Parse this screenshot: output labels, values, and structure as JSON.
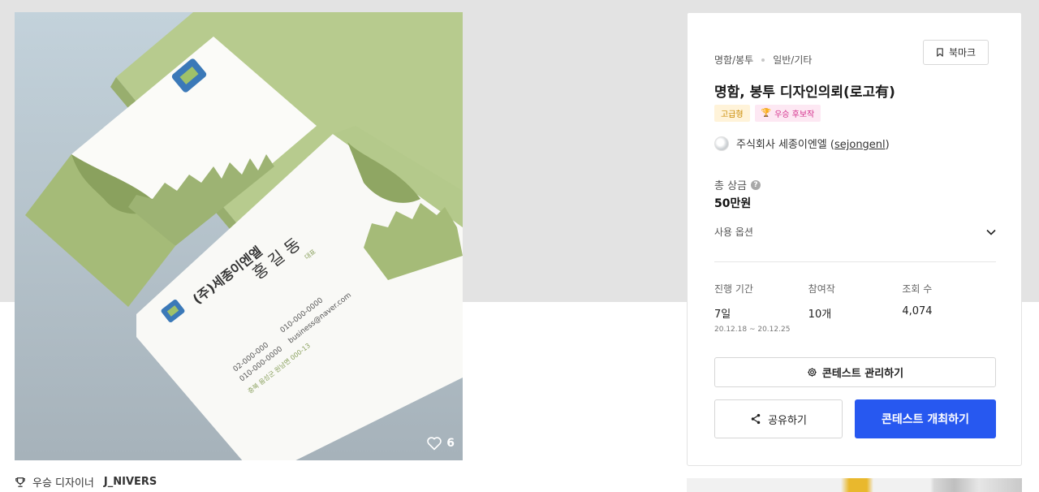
{
  "gallery": {
    "like_count": "6",
    "winner_label": "우승 디자이너",
    "winner_name": "J_NIVERS",
    "card_text": {
      "company": "(주)세종이엔엘",
      "person": "홍 길 동",
      "role": "대표",
      "phone1": "02-000-000",
      "phone2": "010-000-0000",
      "phone3": "010-000-0000",
      "email": "business@naver.com",
      "address": "충북 음성군 원남면 000-13"
    }
  },
  "card": {
    "category": "명함/봉투",
    "subcategory": "일반/기타",
    "bookmark_label": "북마크",
    "title": "명함, 봉투 디자인의뢰(로고有)",
    "badges": [
      "고급형",
      "우승 후보작"
    ],
    "owner_name": "주식회사 세종이엔엘 (",
    "owner_handle": "sejongenl",
    "owner_suffix": ")",
    "prize_label": "총 상금",
    "prize_value": "50만원",
    "options_label": "사용 옵션",
    "stats": [
      {
        "label": "진행 기간",
        "value": "7일",
        "sub": "20.12.18 ~ 20.12.25"
      },
      {
        "label": "참여작",
        "value": "10개",
        "sub": ""
      },
      {
        "label": "조회 수",
        "value": "4,074",
        "sub": ""
      }
    ],
    "manage_label": "콘테스트 관리하기",
    "share_label": "공유하기",
    "open_label": "콘테스트 개최하기"
  },
  "colors": {
    "accent": "#2758f0",
    "card_green": "#a8bd7c",
    "logo_blue": "#3b79b8"
  }
}
